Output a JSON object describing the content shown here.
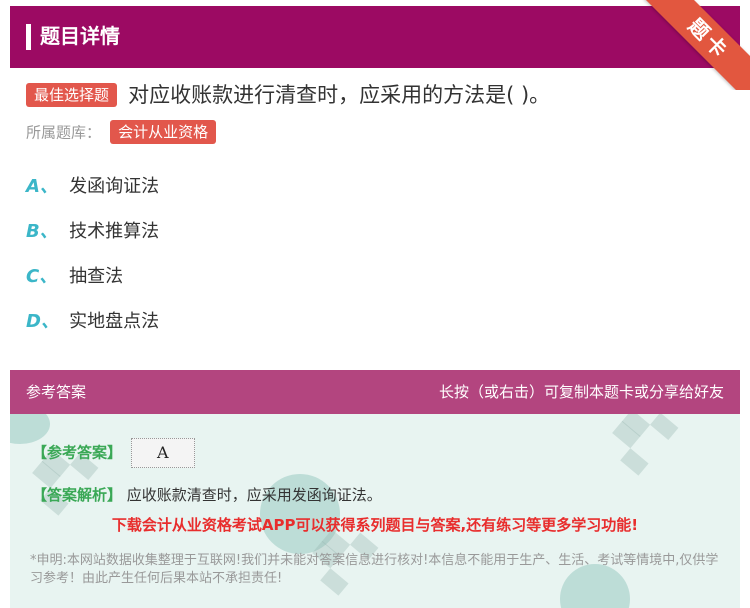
{
  "header": {
    "title": "题目详情"
  },
  "ribbon": {
    "label": "题卡"
  },
  "question": {
    "type_tag": "最佳选择题",
    "text": "对应收账款进行清查时，应采用的方法是( )。"
  },
  "bank": {
    "label": "所属题库：",
    "name": "会计从业资格"
  },
  "options": [
    {
      "letter": "A、",
      "text": "发函询证法"
    },
    {
      "letter": "B、",
      "text": "技术推算法"
    },
    {
      "letter": "C、",
      "text": "抽查法"
    },
    {
      "letter": "D、",
      "text": "实地盘点法"
    }
  ],
  "answer_section": {
    "title": "参考答案",
    "hint": "长按（或右击）可复制本题卡或分享给好友",
    "answer_label": "【参考答案】",
    "answer_value": "A",
    "analysis_label": "【答案解析】",
    "analysis_text": "应收账款清查时，应采用发函询证法。",
    "promo": "下载会计从业资格考试APP可以获得系列题目与答案,还有练习等更多学习功能!",
    "disclaimer": "*申明:本网站数据收集整理于互联网!我们并未能对答案信息进行核对!本信息不能用于生产、生活、考试等情境中,仅供学习参考！由此产生任何后果本站不承担责任!"
  },
  "colors": {
    "header_bg": "#9c0a63",
    "answer_head_bg": "#b3457f",
    "tag_red": "#e2574c",
    "option_letter": "#3bb6c8",
    "answer_label_green": "#3aa856",
    "promo_red": "#e82d2d"
  }
}
